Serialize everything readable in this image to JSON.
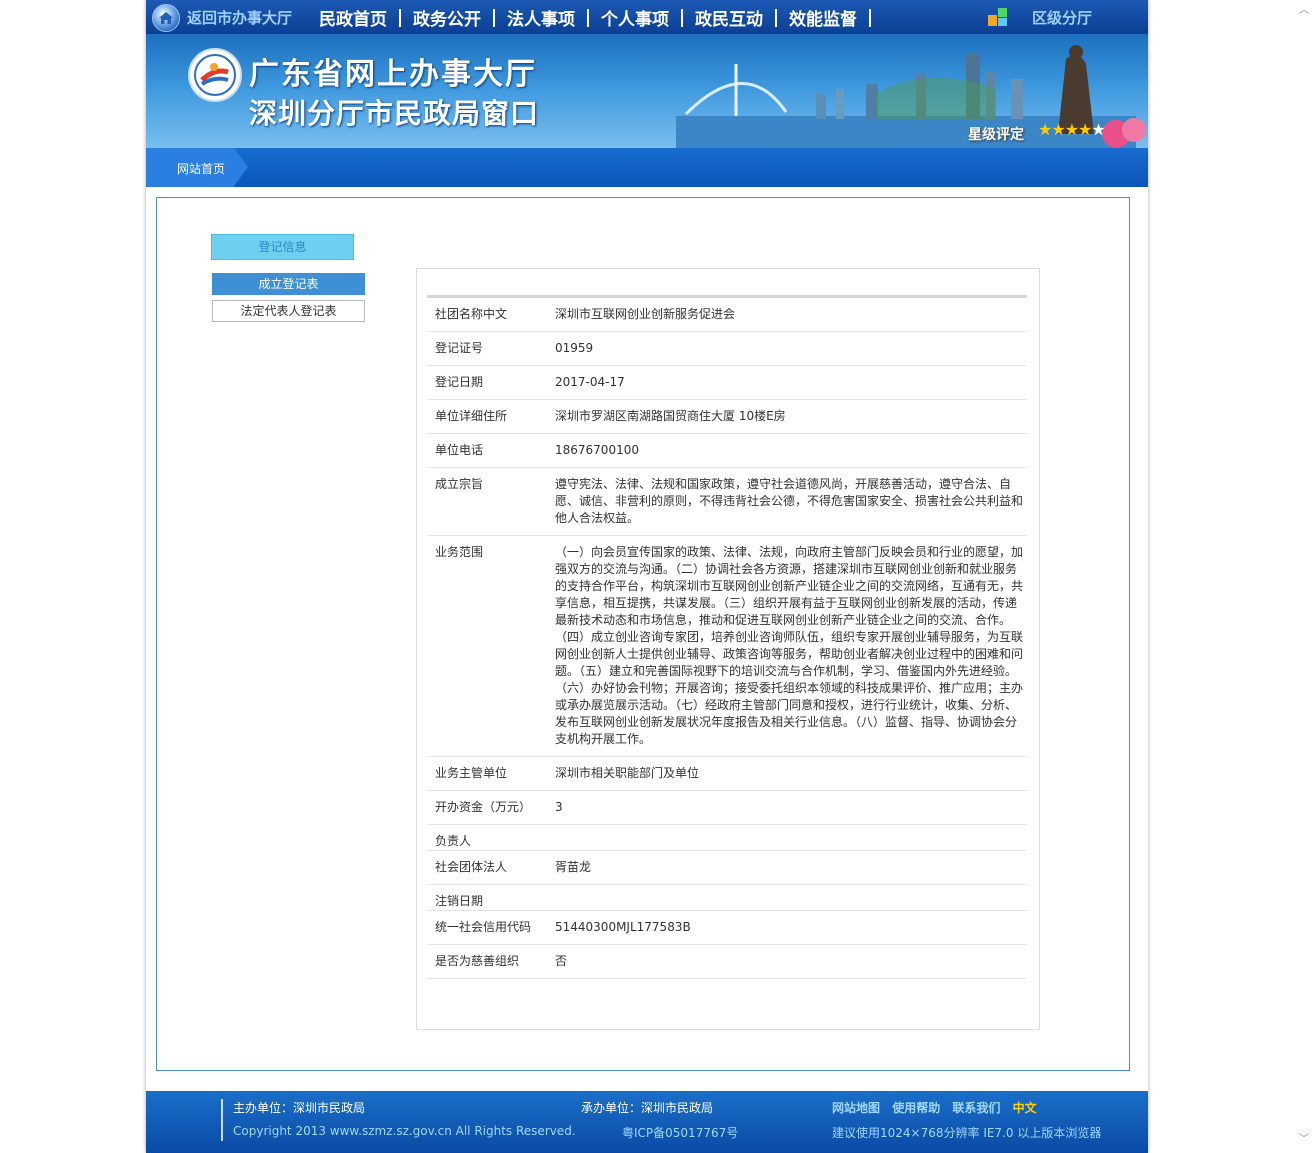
{
  "topnav": {
    "back": "返回市办事大厅",
    "items": [
      "民政首页",
      "政务公开",
      "法人事项",
      "个人事项",
      "政民互动",
      "效能监督"
    ],
    "district": "区级分厅"
  },
  "banner": {
    "title_line1": "广东省网上办事大厅",
    "title_line2": "深圳分厅市民政局窗口",
    "star_label": "星级评定",
    "rating": 4,
    "rating_max": 5
  },
  "breadcrumb": {
    "home": "网站首页"
  },
  "sidebar": {
    "heading": "登记信息",
    "buttons": [
      "成立登记表",
      "法定代表人登记表"
    ]
  },
  "record": {
    "rows": [
      {
        "label": "社团名称中文",
        "value": "深圳市互联网创业创新服务促进会"
      },
      {
        "label": "登记证号",
        "value": "01959"
      },
      {
        "label": "登记日期",
        "value": "2017-04-17"
      },
      {
        "label": "单位详细住所",
        "value": "深圳市罗湖区南湖路国贸商住大厦 10楼E房"
      },
      {
        "label": "单位电话",
        "value": "18676700100"
      },
      {
        "label": "成立宗旨",
        "value": "遵守宪法、法律、法规和国家政策，遵守社会道德风尚，开展慈善活动，遵守合法、自愿、诚信、非营利的原则，不得违背社会公德，不得危害国家安全、损害社会公共利益和他人合法权益。"
      },
      {
        "label": "业务范围",
        "value": "（一）向会员宣传国家的政策、法律、法规，向政府主管部门反映会员和行业的愿望，加强双方的交流与沟通。（二）协调社会各方资源，搭建深圳市互联网创业创新和就业服务的支持合作平台，构筑深圳市互联网创业创新产业链企业之间的交流网络，互通有无，共享信息，相互提携，共谋发展。（三）组织开展有益于互联网创业创新发展的活动，传递最新技术动态和市场信息，推动和促进互联网创业创新产业链企业之间的交流、合作。（四）成立创业咨询专家团，培养创业咨询师队伍，组织专家开展创业辅导服务，为互联网创业创新人士提供创业辅导、政策咨询等服务，帮助创业者解决创业过程中的困难和问题。（五）建立和完善国际视野下的培训交流与合作机制，学习、借鉴国内外先进经验。（六）办好协会刊物；开展咨询；接受委托组织本领域的科技成果评价、推广应用；主办或承办展览展示活动。（七）经政府主管部门同意和授权，进行行业统计，收集、分析、发布互联网创业创新发展状况年度报告及相关行业信息。（八）监督、指导、协调协会分支机构开展工作。"
      },
      {
        "label": "业务主管单位",
        "value": "深圳市相关职能部门及单位"
      },
      {
        "label": "开办资金（万元）",
        "value": "3"
      },
      {
        "label": "负责人",
        "value": ""
      },
      {
        "label": "社会团体法人",
        "value": "胥苗龙"
      },
      {
        "label": "注销日期",
        "value": ""
      },
      {
        "label": "统一社会信用代码",
        "value": "51440300MJL177583B"
      },
      {
        "label": "是否为慈善组织",
        "value": "否"
      }
    ]
  },
  "footer": {
    "host": "主办单位：深圳市民政局",
    "organizer": "承办单位：深圳市民政局",
    "copyright": "Copyright 2013 www.szmz.sz.gov.cn All Rights Reserved.",
    "icp": "粤ICP备05017767号",
    "links": [
      "网站地图",
      "使用帮助",
      "联系我们",
      "中文"
    ],
    "browser_note": "建议使用1024×768分辨率 IE7.0 以上版本浏览器"
  }
}
